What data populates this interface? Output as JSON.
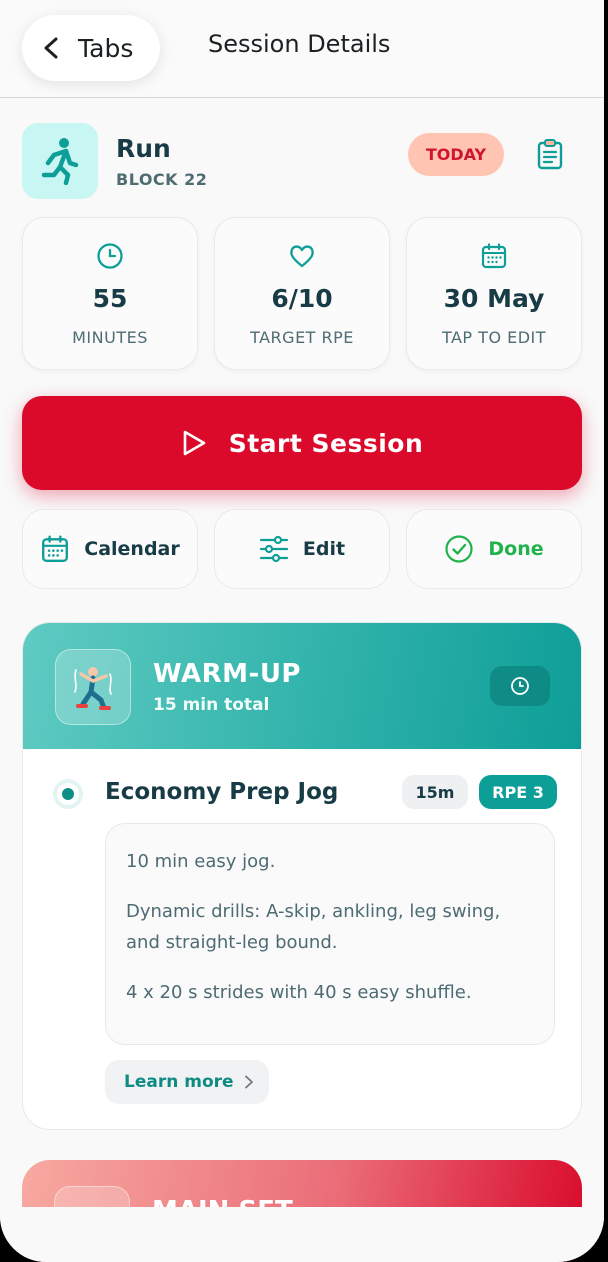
{
  "header": {
    "back_label": "Tabs",
    "title": "Session Details"
  },
  "session": {
    "title": "Run",
    "subtitle": "BLOCK 22",
    "badge": "TODAY",
    "accent_color": "#0E9E98",
    "badge_color": "#D0162F"
  },
  "stats": [
    {
      "icon": "clock-icon",
      "value": "55",
      "label": "MINUTES"
    },
    {
      "icon": "heart-icon",
      "value": "6/10",
      "label": "TARGET RPE"
    },
    {
      "icon": "calendar-icon",
      "value": "30 May",
      "label": "TAP TO EDIT"
    }
  ],
  "start_button": {
    "label": "Start Session",
    "color": "#DB0A2B"
  },
  "actions": [
    {
      "icon": "calendar-icon",
      "label": "Calendar"
    },
    {
      "icon": "sliders-icon",
      "label": "Edit"
    },
    {
      "icon": "check-circle-icon",
      "label": "Done"
    }
  ],
  "warmup": {
    "title": "WARM-UP",
    "subtitle": "15 min total",
    "exercise": {
      "title": "Economy Prep Jog",
      "duration": "15m",
      "rpe": "RPE 3",
      "notes": [
        "10 min easy jog.",
        "Dynamic drills: A-skip, ankling, leg swing, and straight-leg bound.",
        "4 x 20 s strides with 40 s easy shuffle."
      ],
      "learn_more": "Learn more"
    }
  },
  "main_set": {
    "title": "MAIN SET"
  }
}
